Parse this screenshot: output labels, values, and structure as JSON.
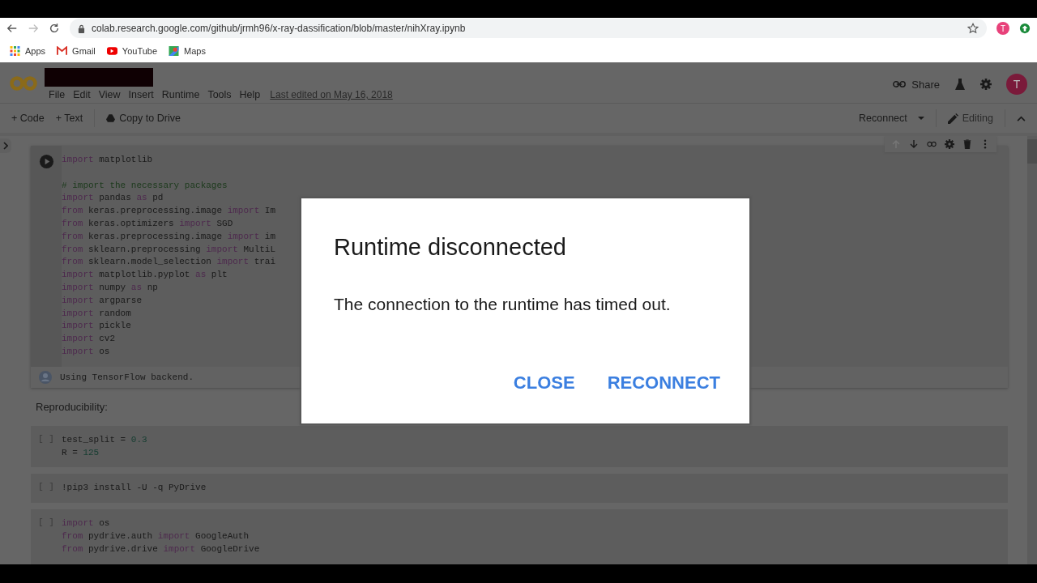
{
  "browser": {
    "url": "colab.research.google.com/github/jrmh96/x-ray-dassification/blob/master/nihXray.ipynb",
    "profile_initial": "T",
    "bookmarks": [
      {
        "label": "Apps"
      },
      {
        "label": "Gmail"
      },
      {
        "label": "YouTube"
      },
      {
        "label": "Maps"
      }
    ]
  },
  "notebook": {
    "menu": [
      "File",
      "Edit",
      "View",
      "Insert",
      "Runtime",
      "Tools",
      "Help"
    ],
    "last_edited": "Last edited on May 16, 2018",
    "share": "Share",
    "avatar_initial": "T",
    "toolbar": {
      "add_code": "+ Code",
      "add_text": "+ Text",
      "copy": "Copy to Drive",
      "reconnect": "Reconnect",
      "mode": "Editing"
    },
    "cells": [
      {
        "kind": "code",
        "lines": [
          {
            "tokens": [
              {
                "t": "import",
                "color": "#4e2a4e"
              },
              {
                "t": " matplotlib"
              }
            ]
          },
          {
            "gap_before": true,
            "tokens": [
              {
                "t": "# import the necessary packages",
                "color": "#1c3a1c"
              }
            ]
          },
          {
            "tokens": [
              {
                "t": "import",
                "color": "#4e2a4e"
              },
              {
                "t": " pandas "
              },
              {
                "t": "as",
                "color": "#4e2a4e"
              },
              {
                "t": " pd"
              }
            ]
          },
          {
            "tokens": [
              {
                "t": "from",
                "color": "#4e2a4e"
              },
              {
                "t": " keras.preprocessing.image "
              },
              {
                "t": "import",
                "color": "#4e2a4e"
              },
              {
                "t": " Im"
              }
            ]
          },
          {
            "tokens": [
              {
                "t": "from",
                "color": "#4e2a4e"
              },
              {
                "t": " keras.optimizers "
              },
              {
                "t": "import",
                "color": "#4e2a4e"
              },
              {
                "t": " SGD"
              }
            ]
          },
          {
            "tokens": [
              {
                "t": "from",
                "color": "#4e2a4e"
              },
              {
                "t": " keras.preprocessing.image "
              },
              {
                "t": "import",
                "color": "#4e2a4e"
              },
              {
                "t": " im"
              }
            ]
          },
          {
            "tokens": [
              {
                "t": "from",
                "color": "#4e2a4e"
              },
              {
                "t": " sklearn.preprocessing "
              },
              {
                "t": "import",
                "color": "#4e2a4e"
              },
              {
                "t": " MultiL"
              }
            ]
          },
          {
            "tokens": [
              {
                "t": "from",
                "color": "#4e2a4e"
              },
              {
                "t": " sklearn.model_selection "
              },
              {
                "t": "import",
                "color": "#4e2a4e"
              },
              {
                "t": " trai"
              }
            ]
          },
          {
            "tokens": [
              {
                "t": "import",
                "color": "#4e2a4e"
              },
              {
                "t": " matplotlib.pyplot "
              },
              {
                "t": "as",
                "color": "#4e2a4e"
              },
              {
                "t": " plt"
              }
            ]
          },
          {
            "tokens": [
              {
                "t": "import",
                "color": "#4e2a4e"
              },
              {
                "t": " numpy "
              },
              {
                "t": "as",
                "color": "#4e2a4e"
              },
              {
                "t": " np"
              }
            ]
          },
          {
            "tokens": [
              {
                "t": "import",
                "color": "#4e2a4e"
              },
              {
                "t": " argparse"
              }
            ]
          },
          {
            "tokens": [
              {
                "t": "import",
                "color": "#4e2a4e"
              },
              {
                "t": " random"
              }
            ]
          },
          {
            "tokens": [
              {
                "t": "import",
                "color": "#4e2a4e"
              },
              {
                "t": " pickle"
              }
            ]
          },
          {
            "tokens": [
              {
                "t": "import",
                "color": "#4e2a4e"
              },
              {
                "t": " cv2"
              }
            ]
          },
          {
            "tokens": [
              {
                "t": "import",
                "color": "#4e2a4e"
              },
              {
                "t": " os"
              }
            ]
          }
        ],
        "output": "Using TensorFlow backend."
      },
      {
        "kind": "text",
        "text": "Reproducibility:"
      },
      {
        "kind": "code",
        "run_label": "[ ]",
        "lines": [
          {
            "tokens": [
              {
                "t": "test_split = "
              },
              {
                "t": "0.3",
                "color": "#143c30"
              }
            ]
          },
          {
            "tokens": [
              {
                "t": "R = "
              },
              {
                "t": "125",
                "color": "#143c30"
              }
            ]
          }
        ]
      },
      {
        "kind": "code",
        "run_label": "[ ]",
        "lines": [
          {
            "tokens": [
              {
                "t": "!pip3 install -U -q PyDrive"
              }
            ]
          }
        ]
      },
      {
        "kind": "code",
        "run_label": "[ ]",
        "lines": [
          {
            "tokens": [
              {
                "t": "import",
                "color": "#4e2a4e"
              },
              {
                "t": " os"
              }
            ]
          },
          {
            "tokens": [
              {
                "t": "from",
                "color": "#4e2a4e"
              },
              {
                "t": " pydrive.auth "
              },
              {
                "t": "import",
                "color": "#4e2a4e"
              },
              {
                "t": " GoogleAuth"
              }
            ]
          },
          {
            "tokens": [
              {
                "t": "from",
                "color": "#4e2a4e"
              },
              {
                "t": " pydrive.drive "
              },
              {
                "t": "import",
                "color": "#4e2a4e"
              },
              {
                "t": " GoogleDrive"
              }
            ]
          }
        ]
      }
    ]
  },
  "dialog": {
    "title": "Runtime disconnected",
    "message": "The connection to the runtime has timed out.",
    "buttons": [
      "CLOSE",
      "RECONNECT"
    ]
  }
}
